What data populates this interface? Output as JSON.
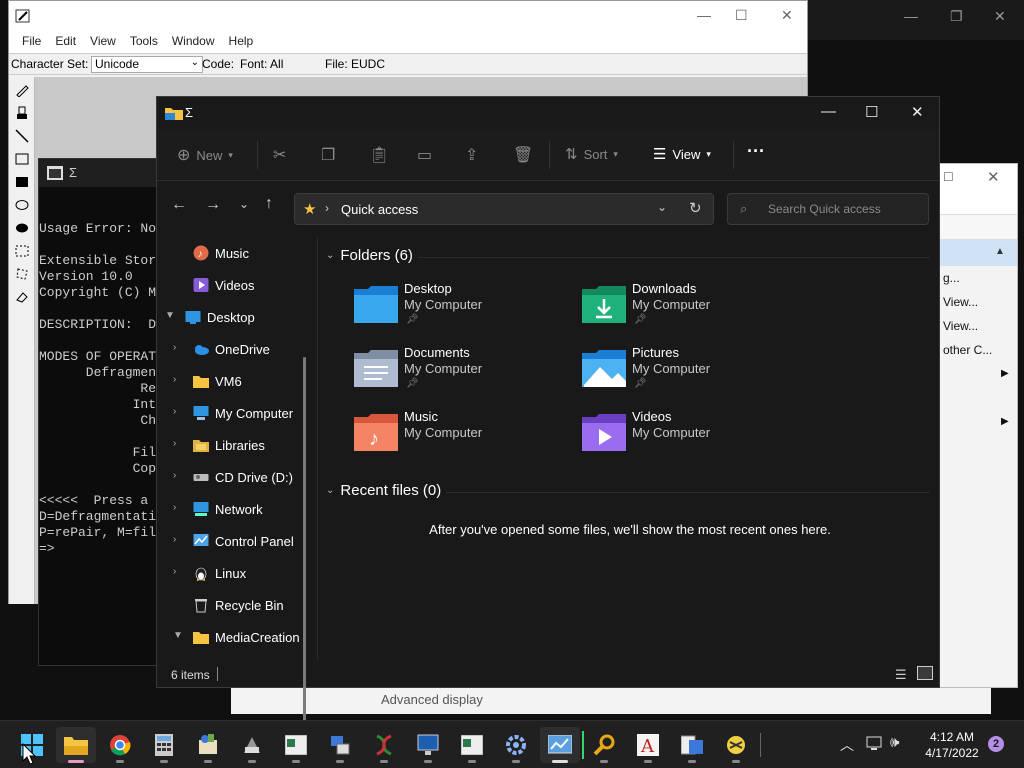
{
  "pce": {
    "menu": [
      "File",
      "Edit",
      "View",
      "Tools",
      "Window",
      "Help"
    ],
    "charset_label": "Character Set:",
    "charset_value": "Unicode",
    "code_label": "Code:",
    "font_label": "Font: All",
    "file_label": "File: EUDC"
  },
  "console": {
    "title": "Σ",
    "text": "\nUsage Error: No\n\nExtensible Stor\nVersion 10.0\nCopyright (C) M\n\nDESCRIPTION:  D\n\nMODES OF OPERAT\n      Defragmen\n             Re\n            Int\n             Ch\n\n            Fil\n            Cop\n\n<<<<<  Press a\nD=Defragmentati\nP=rePair, M=fil\n=>"
  },
  "right_window": {
    "items": [
      "g...",
      "View...",
      "View...",
      "other C..."
    ],
    "bottom_text": "Advanced display"
  },
  "explorer": {
    "title": "Σ",
    "toolbar": {
      "new_label": "New",
      "sort_label": "Sort",
      "view_label": "View",
      "more_label": "···"
    },
    "address": "Quick access",
    "search_placeholder": "Search Quick access",
    "sidebar": [
      {
        "label": "Music",
        "icon": "music-icon",
        "chevron": ""
      },
      {
        "label": "Videos",
        "icon": "videos-icon",
        "chevron": ""
      },
      {
        "label": "Desktop",
        "icon": "desktop-icon",
        "chevron": "▼"
      },
      {
        "label": "OneDrive",
        "icon": "onedrive-icon",
        "chevron": "›"
      },
      {
        "label": "VM6",
        "icon": "folder-icon",
        "chevron": "›"
      },
      {
        "label": "My Computer",
        "icon": "computer-icon",
        "chevron": "›"
      },
      {
        "label": "Libraries",
        "icon": "libraries-icon",
        "chevron": "›"
      },
      {
        "label": "CD Drive (D:)",
        "icon": "cd-drive-icon",
        "chevron": "›"
      },
      {
        "label": "Network",
        "icon": "network-icon",
        "chevron": "›"
      },
      {
        "label": "Control Panel",
        "icon": "control-panel-icon",
        "chevron": "›"
      },
      {
        "label": "Linux",
        "icon": "linux-icon",
        "chevron": "›"
      },
      {
        "label": "Recycle Bin",
        "icon": "recycle-bin-icon",
        "chevron": ""
      },
      {
        "label": "MediaCreation",
        "icon": "folder-icon",
        "chevron": "▼"
      }
    ],
    "folders_header": "Folders (6)",
    "folders": [
      {
        "name": "Desktop",
        "location": "My Computer",
        "pinned": true
      },
      {
        "name": "Downloads",
        "location": "My Computer",
        "pinned": true
      },
      {
        "name": "Documents",
        "location": "My Computer",
        "pinned": true
      },
      {
        "name": "Pictures",
        "location": "My Computer",
        "pinned": true
      },
      {
        "name": "Music",
        "location": "My Computer",
        "pinned": false
      },
      {
        "name": "Videos",
        "location": "My Computer",
        "pinned": false
      }
    ],
    "recent_header": "Recent files (0)",
    "recent_empty": "After you've opened some files, we'll show the most recent ones here.",
    "status": "6 items"
  },
  "taskbar": {
    "time": "4:12 AM",
    "date": "4/17/2022",
    "notification_count": "2"
  },
  "colors": {
    "explorer_bg": "#191919",
    "taskbar_bg": "#202020",
    "accent_pink": "#e59ac9",
    "folder_yellow": "#f6c343"
  }
}
